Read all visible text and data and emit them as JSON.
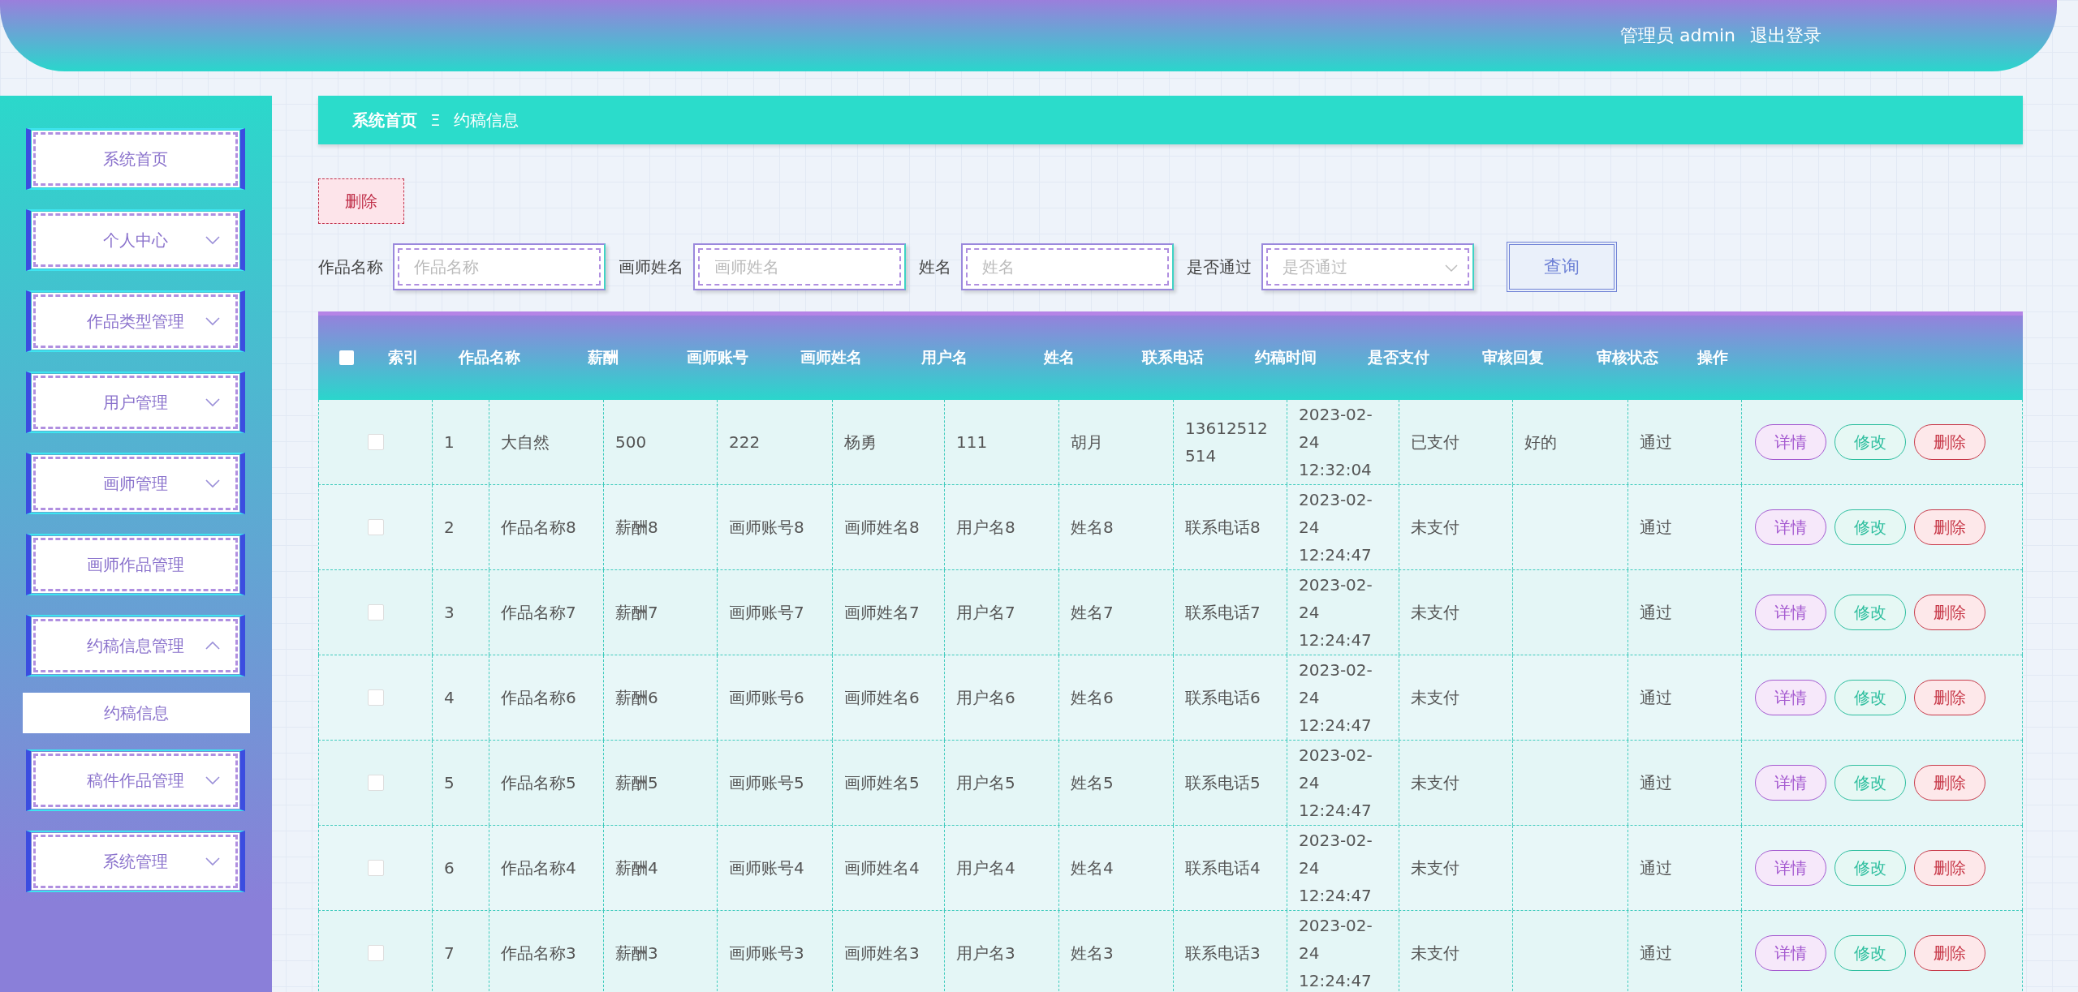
{
  "header": {
    "user": "管理员 admin",
    "logout": "退出登录"
  },
  "sidebar": {
    "items": [
      {
        "label": "系统首页",
        "kind": "link"
      },
      {
        "label": "个人中心",
        "kind": "submenu",
        "expanded": false
      },
      {
        "label": "作品类型管理",
        "kind": "submenu",
        "expanded": false
      },
      {
        "label": "用户管理",
        "kind": "submenu",
        "expanded": false
      },
      {
        "label": "画师管理",
        "kind": "submenu",
        "expanded": false
      },
      {
        "label": "画师作品管理",
        "kind": "link"
      },
      {
        "label": "约稿信息管理",
        "kind": "submenu",
        "expanded": true,
        "children": [
          {
            "label": "约稿信息",
            "selected": true
          }
        ]
      },
      {
        "label": "稿件作品管理",
        "kind": "submenu",
        "expanded": false
      },
      {
        "label": "系统管理",
        "kind": "submenu",
        "expanded": false
      }
    ]
  },
  "breadcrumb": {
    "home": "系统首页",
    "separator": "Ξ",
    "current": "约稿信息"
  },
  "delete_button": "删除",
  "search": {
    "fields": [
      {
        "label": "作品名称",
        "placeholder": "作品名称",
        "kind": "input"
      },
      {
        "label": "画师姓名",
        "placeholder": "画师姓名",
        "kind": "input"
      },
      {
        "label": "姓名",
        "placeholder": "姓名",
        "kind": "input"
      },
      {
        "label": "是否通过",
        "placeholder": "是否通过",
        "kind": "select"
      }
    ],
    "button": "查询"
  },
  "table": {
    "select_all": {
      "checked": false
    },
    "columns": [
      "索引",
      "作品名称",
      "薪酬",
      "画师账号",
      "画师姓名",
      "用户名",
      "姓名",
      "联系电话",
      "约稿时间",
      "是否支付",
      "审核回复",
      "审核状态",
      "操作"
    ],
    "rows": [
      {
        "checked": false,
        "cells": [
          "1",
          "大自然",
          "500",
          "222",
          "杨勇",
          "111",
          "胡月",
          "13612512514",
          "2023-02-24 12:32:04",
          "已支付",
          "好的",
          "通过"
        ],
        "actions": [
          {
            "label": "详情",
            "kind": "detail"
          },
          {
            "label": "修改",
            "kind": "edit"
          },
          {
            "label": "删除",
            "kind": "delete"
          }
        ]
      },
      {
        "checked": false,
        "cells": [
          "2",
          "作品名称8",
          "薪酬8",
          "画师账号8",
          "画师姓名8",
          "用户名8",
          "姓名8",
          "联系电话8",
          "2023-02-24 12:24:47",
          "未支付",
          "",
          "通过"
        ],
        "actions": [
          {
            "label": "详情",
            "kind": "detail"
          },
          {
            "label": "修改",
            "kind": "edit"
          },
          {
            "label": "删除",
            "kind": "delete"
          }
        ]
      },
      {
        "checked": false,
        "cells": [
          "3",
          "作品名称7",
          "薪酬7",
          "画师账号7",
          "画师姓名7",
          "用户名7",
          "姓名7",
          "联系电话7",
          "2023-02-24 12:24:47",
          "未支付",
          "",
          "通过"
        ],
        "actions": [
          {
            "label": "详情",
            "kind": "detail"
          },
          {
            "label": "修改",
            "kind": "edit"
          },
          {
            "label": "删除",
            "kind": "delete"
          }
        ]
      },
      {
        "checked": false,
        "cells": [
          "4",
          "作品名称6",
          "薪酬6",
          "画师账号6",
          "画师姓名6",
          "用户名6",
          "姓名6",
          "联系电话6",
          "2023-02-24 12:24:47",
          "未支付",
          "",
          "通过"
        ],
        "actions": [
          {
            "label": "详情",
            "kind": "detail"
          },
          {
            "label": "修改",
            "kind": "edit"
          },
          {
            "label": "删除",
            "kind": "delete"
          }
        ]
      },
      {
        "checked": false,
        "cells": [
          "5",
          "作品名称5",
          "薪酬5",
          "画师账号5",
          "画师姓名5",
          "用户名5",
          "姓名5",
          "联系电话5",
          "2023-02-24 12:24:47",
          "未支付",
          "",
          "通过"
        ],
        "actions": [
          {
            "label": "详情",
            "kind": "detail"
          },
          {
            "label": "修改",
            "kind": "edit"
          },
          {
            "label": "删除",
            "kind": "delete"
          }
        ]
      },
      {
        "checked": false,
        "cells": [
          "6",
          "作品名称4",
          "薪酬4",
          "画师账号4",
          "画师姓名4",
          "用户名4",
          "姓名4",
          "联系电话4",
          "2023-02-24 12:24:47",
          "未支付",
          "",
          "通过"
        ],
        "actions": [
          {
            "label": "详情",
            "kind": "detail"
          },
          {
            "label": "修改",
            "kind": "edit"
          },
          {
            "label": "删除",
            "kind": "delete"
          }
        ]
      },
      {
        "checked": false,
        "cells": [
          "7",
          "作品名称3",
          "薪酬3",
          "画师账号3",
          "画师姓名3",
          "用户名3",
          "姓名3",
          "联系电话3",
          "2023-02-24 12:24:47",
          "未支付",
          "",
          "通过"
        ],
        "actions": [
          {
            "label": "详情",
            "kind": "detail"
          },
          {
            "label": "修改",
            "kind": "edit"
          },
          {
            "label": "删除",
            "kind": "delete"
          }
        ]
      }
    ]
  }
}
